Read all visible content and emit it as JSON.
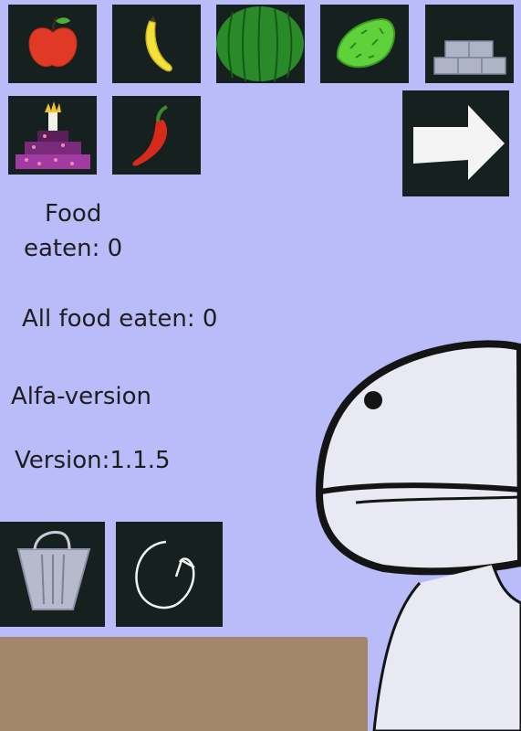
{
  "food_items": [
    {
      "name": "apple-icon"
    },
    {
      "name": "banana-icon"
    },
    {
      "name": "watermelon-icon"
    },
    {
      "name": "lime-icon"
    },
    {
      "name": "bricks-icon"
    },
    {
      "name": "cake-icon"
    },
    {
      "name": "chili-pepper-icon"
    }
  ],
  "next_button": {
    "icon": "arrow-right-icon"
  },
  "stats": {
    "food_eaten_line1": "Food",
    "food_eaten_line2": "eaten: 0",
    "all_food_eaten": "All food eaten: 0"
  },
  "version": {
    "stage": "Alfa-version",
    "number": "Version:1.1.5"
  },
  "controls": {
    "trash_icon": "trash-bin-icon",
    "reset_icon": "refresh-icon"
  },
  "colors": {
    "background": "#b9bcf9",
    "tile": "#16201f",
    "table": "#a4876a",
    "creature": "#e8e9f3"
  }
}
